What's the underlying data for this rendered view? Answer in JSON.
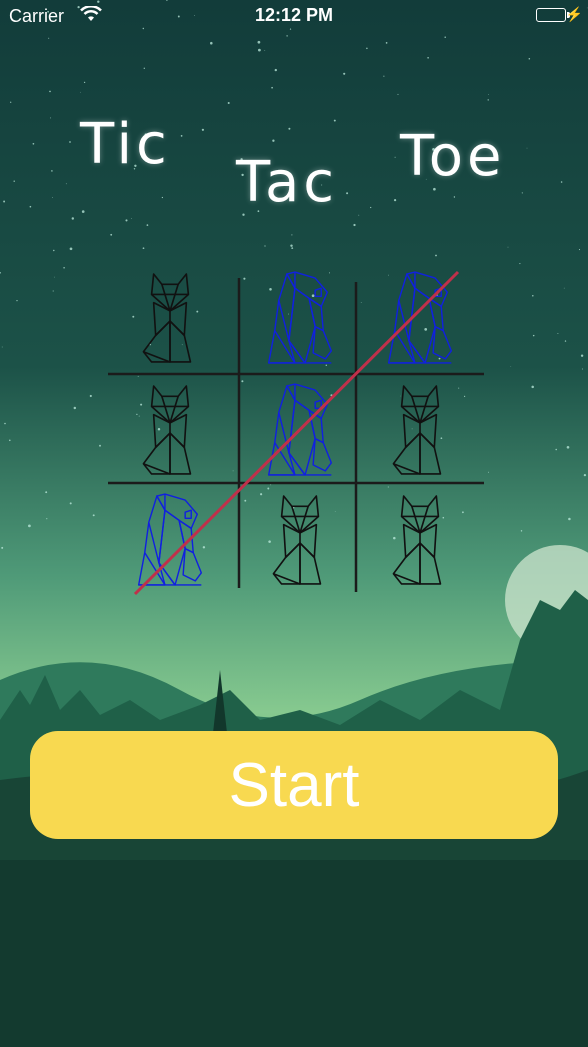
{
  "status_bar": {
    "carrier": "Carrier",
    "time": "12:12 PM",
    "battery_color": "#4cd964"
  },
  "title": {
    "word1": "Tic",
    "word2": "Tac",
    "word3": "Toe"
  },
  "board": {
    "cells": [
      [
        "fox",
        "bear",
        "bear"
      ],
      [
        "fox",
        "bear",
        "fox"
      ],
      [
        "bear",
        "fox",
        "fox"
      ]
    ],
    "piece_colors": {
      "fox": "#111111",
      "bear": "#1020e0"
    },
    "win_line_color": "#c0304a"
  },
  "start_button": {
    "label": "Start",
    "color": "#f8d950"
  }
}
